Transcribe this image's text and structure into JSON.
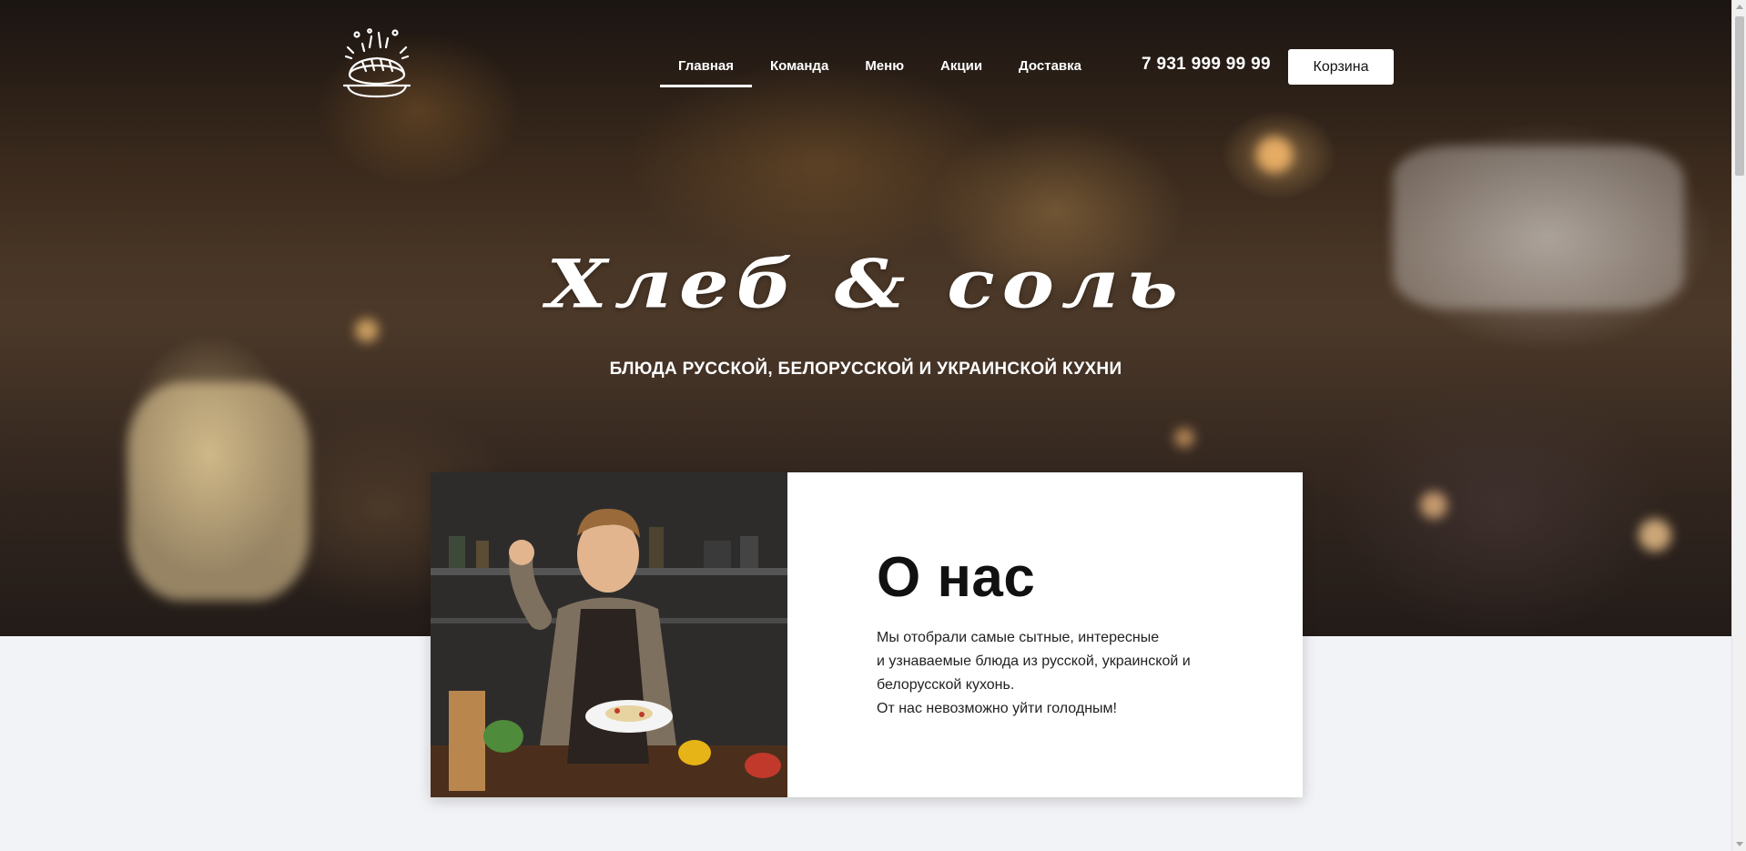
{
  "header": {
    "logo_alt": "logo",
    "nav": [
      {
        "label": "Главная",
        "active": true
      },
      {
        "label": "Команда",
        "active": false
      },
      {
        "label": "Меню",
        "active": false
      },
      {
        "label": "Акции",
        "active": false
      },
      {
        "label": "Доставка",
        "active": false
      }
    ],
    "phone": "7 931 999 99 99",
    "cart_label": "Корзина"
  },
  "hero": {
    "title": "Хлеб & соль",
    "subtitle": "БЛЮДА РУССКОЙ, БЕЛОРУССКОЙ И УКРАИНСКОЙ КУХНИ"
  },
  "about": {
    "title": "О нас",
    "lines": [
      "Мы отобрали самые сытные, интересные",
      "и узнаваемые блюда из русской, украинской и",
      "белорусской кухонь.",
      "От нас невозможно уйти голодным!"
    ],
    "photo_icon": "chef-photo"
  },
  "colors": {
    "accent": "#ffffff",
    "page_bg": "#f2f3f6",
    "text": "#111111"
  }
}
